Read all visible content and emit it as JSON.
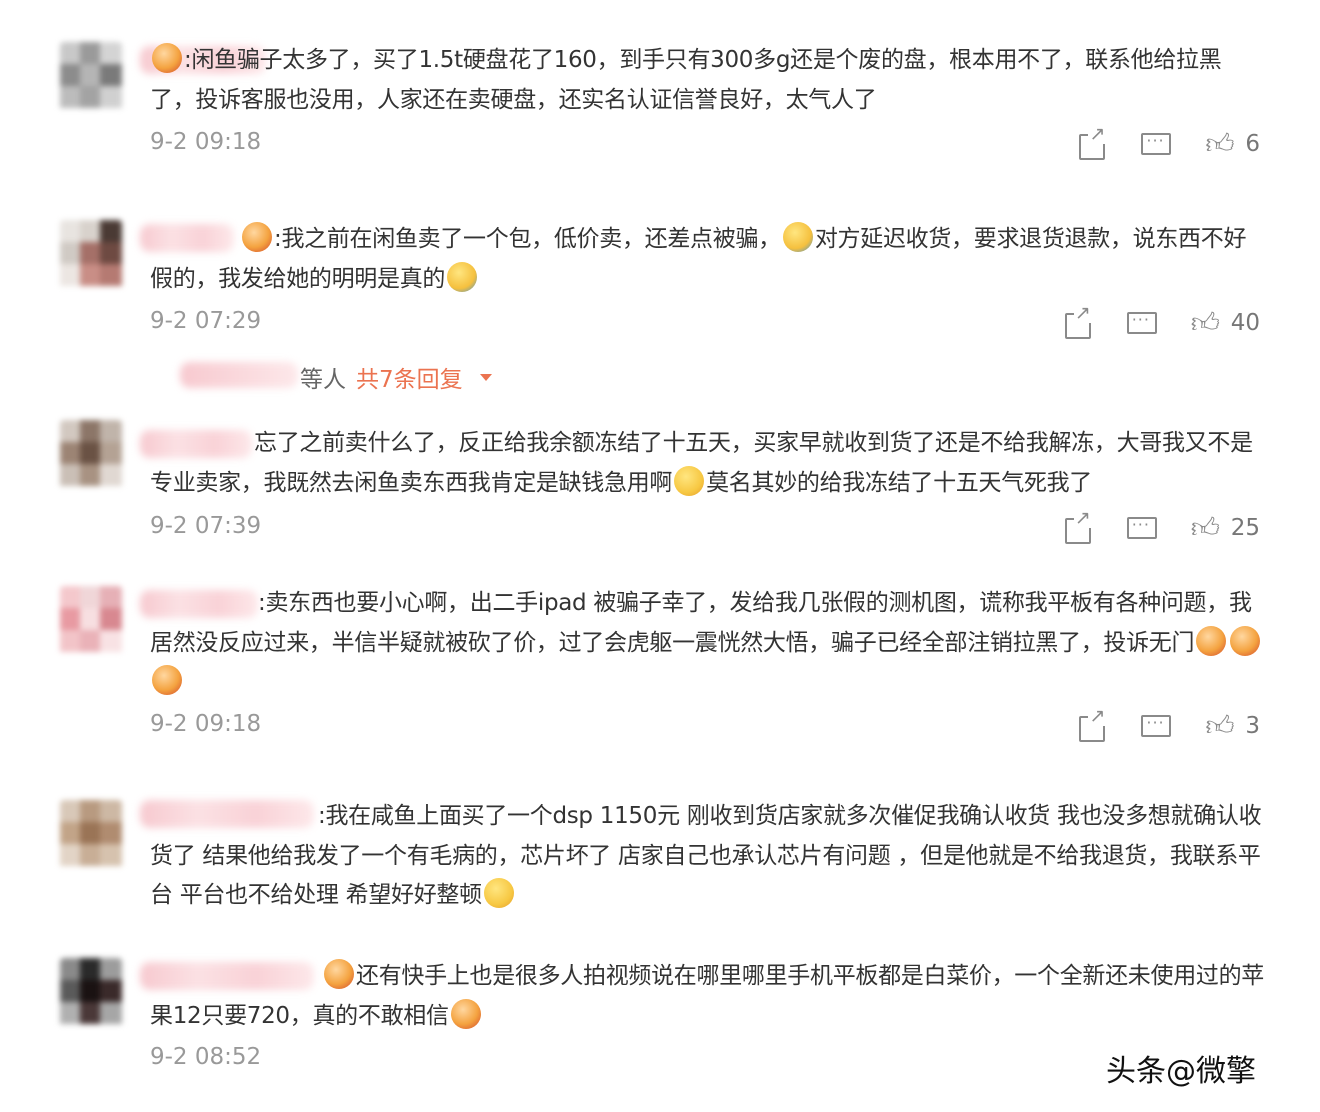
{
  "comments": [
    {
      "text": ":闲鱼骗子太多了，买了1.5t硬盘花了160，到手只有300多g还是个废的盘，根本用不了，联系他给拉黑了，投诉客服也没用，人家还在卖硬盘，还实名认证信誉良好，太气人了",
      "time": "9-2 09:18",
      "likes": "6"
    },
    {
      "text_a": ":我之前在闲鱼卖了一个包，低价卖，还差点被骗，",
      "text_b": "对方延迟收货，要求退货退款，说东西不好假的，我发给她的明明是真的",
      "time": "9-2 07:29",
      "likes": "40",
      "replies_who": "等人",
      "replies_count": "共7条回复"
    },
    {
      "text_a": "忘了之前卖什么了，反正给我余额冻结了十五天，买家早就收到货了还是不给我解冻，大哥我又不是专业卖家，我既然去闲鱼卖东西我肯定是缺钱急用啊",
      "text_b": "莫名其妙的给我冻结了十五天气死我了",
      "time": "9-2 07:39",
      "likes": "25"
    },
    {
      "text": ":卖东西也要小心啊，出二手ipad 被骗子幸了，发给我几张假的测机图，谎称我平板有各种问题，我居然没反应过来，半信半疑就被砍了价，过了会虎躯一震恍然大悟，骗子已经全部注销拉黑了，投诉无门",
      "time": "9-2 09:18",
      "likes": "3"
    },
    {
      "text": ":我在咸鱼上面买了一个dsp 1150元 刚收到货店家就多次催促我确认收货 我也没多想就确认收货了 结果他给我发了一个有毛病的，芯片坏了 店家自己也承认芯片有问题 ，但是他就是不给我退货，我联系平台 平台也不给处理 希望好好整顿",
      "time": "",
      "likes": ""
    },
    {
      "text": "还有快手上也是很多人拍视频说在哪里哪里手机平板都是白菜价，一个全新还未使用过的苹果12只要720，真的不敢相信",
      "time": "9-2 08:52",
      "likes": ""
    }
  ],
  "watermark": "头条@微擎",
  "icons": [
    "share-icon",
    "comment-icon",
    "like-icon"
  ],
  "colors": {
    "accent": "#eb7350",
    "meta": "#999999",
    "text": "#333333"
  }
}
